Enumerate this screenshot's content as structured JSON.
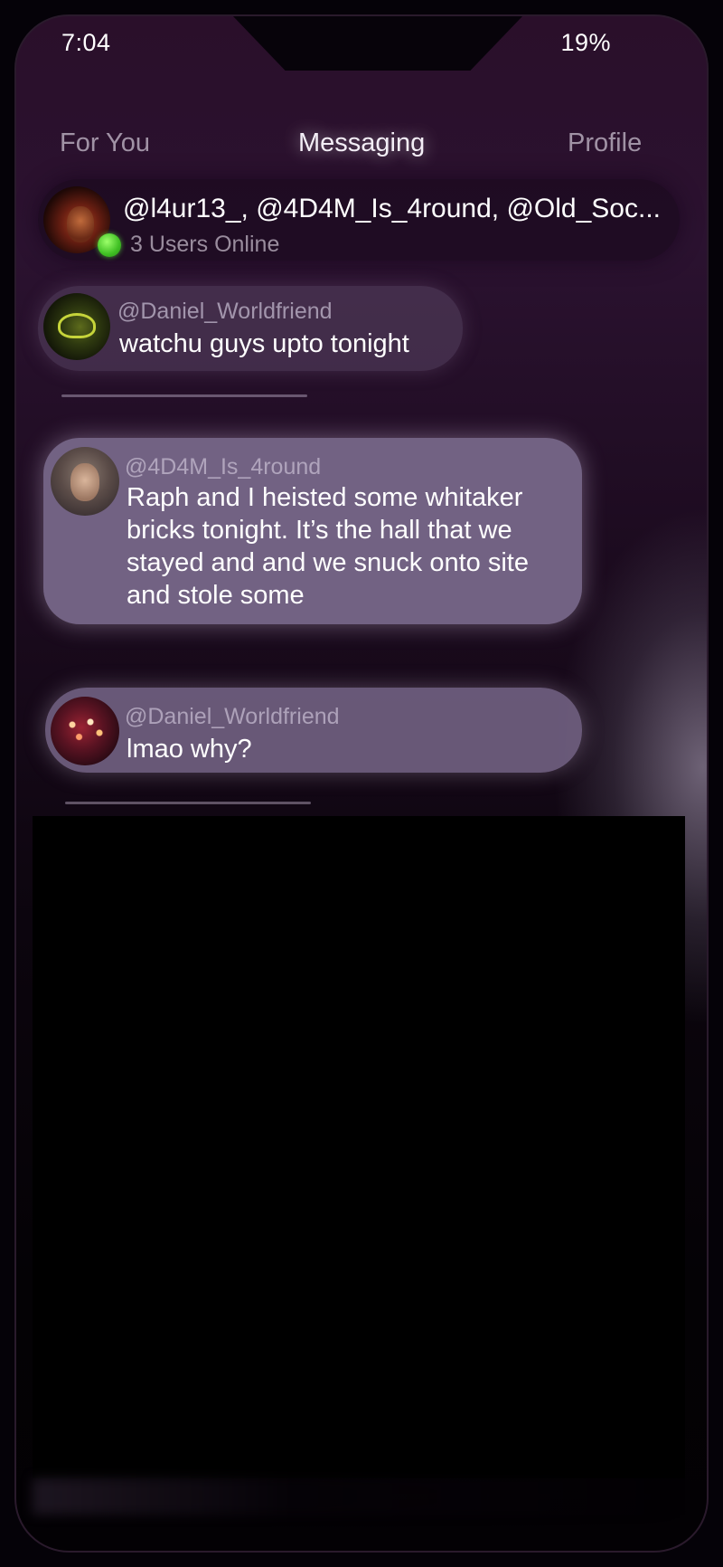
{
  "status_bar": {
    "time": "7:04",
    "battery": "19%"
  },
  "nav": {
    "tabs": [
      {
        "label": "For You",
        "active": false
      },
      {
        "label": "Messaging",
        "active": true
      },
      {
        "label": "Profile",
        "active": false
      }
    ]
  },
  "group": {
    "members": "@l4ur13_, @4D4M_Is_4round, @Old_Soc...",
    "online_status": "3 Users Online"
  },
  "messages": [
    {
      "handle": "@Daniel_Worldfriend",
      "text": "watchu guys upto tonight"
    },
    {
      "handle": "@4D4M_Is_4round",
      "text": "Raph and I heisted some whitaker bricks tonight. It’s the hall that we stayed and and we snuck onto site and stole some"
    },
    {
      "handle": "@Daniel_Worldfriend",
      "text": "lmao why?"
    }
  ],
  "icons": {
    "online_indicator": "online-dot-icon"
  },
  "colors": {
    "online_green": "#3fbf23",
    "bubble_highlight": "#726283"
  }
}
